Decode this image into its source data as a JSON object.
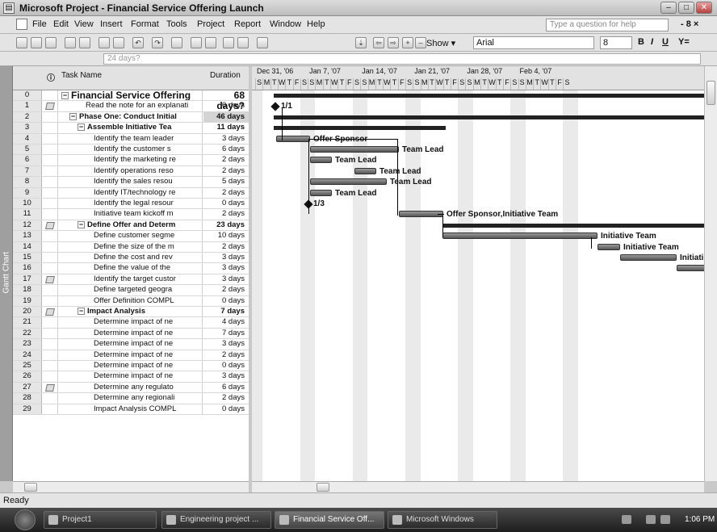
{
  "window": {
    "title": "Microsoft Project - Financial Service Offering Launch",
    "app_icon": "project-app-icon",
    "minimize_glyph": "–",
    "maximize_glyph": "□",
    "close_glyph": "✕"
  },
  "menu": {
    "items": [
      "File",
      "Edit",
      "View",
      "Insert",
      "Format",
      "Tools",
      "Project",
      "Report",
      "Window",
      "Help"
    ],
    "help_placeholder": "Type a question for help",
    "doc_controls": "- 8 ×"
  },
  "toolbar": {
    "icons": [
      "new-icon",
      "open-icon",
      "save-icon",
      "print-icon",
      "print-preview-icon",
      "cut-icon",
      "copy-icon",
      "undo-icon",
      "redo-icon",
      "hyperlink-icon",
      "link-tasks-icon",
      "unlink-tasks-icon",
      "split-icon",
      "task-info-icon",
      "group-icon",
      "scroll-to-task-icon",
      "indent-icon",
      "outdent-icon",
      "show-subtasks-icon",
      "hide-subtasks-icon"
    ],
    "show_label": "Show ▾",
    "font": "Arial",
    "font_size": "8",
    "bold": "B",
    "italic": "I",
    "underline": "U",
    "filter": "Y="
  },
  "entry": {
    "value": "24 days?"
  },
  "viewbar": {
    "label": "Gantt Chart"
  },
  "table": {
    "headers": {
      "id": "",
      "indicator": "ⓘ",
      "name": "Task Name",
      "duration": "Duration"
    },
    "rows": [
      {
        "id": "0",
        "name": "Financial Service Offering",
        "duration": "68 days?",
        "level": 0,
        "summary": true,
        "big": true,
        "note": false
      },
      {
        "id": "1",
        "name": "Read the note for an explanati",
        "duration": "0 days",
        "level": 3,
        "summary": false,
        "note": true
      },
      {
        "id": "2",
        "name": "Phase One: Conduct Initial",
        "duration": "46 days",
        "level": 1,
        "summary": true,
        "note": false,
        "hl": true
      },
      {
        "id": "3",
        "name": "Assemble Initiative Tea",
        "duration": "11 days",
        "level": 2,
        "summary": true,
        "note": false
      },
      {
        "id": "4",
        "name": "Identify the team leader",
        "duration": "3 days",
        "level": 4,
        "summary": false,
        "note": false
      },
      {
        "id": "5",
        "name": "Identify the customer s",
        "duration": "6 days",
        "level": 4,
        "summary": false,
        "note": false
      },
      {
        "id": "6",
        "name": "Identify the marketing re",
        "duration": "2 days",
        "level": 4,
        "summary": false,
        "note": false
      },
      {
        "id": "7",
        "name": "Identify operations reso",
        "duration": "2 days",
        "level": 4,
        "summary": false,
        "note": false
      },
      {
        "id": "8",
        "name": "Identify the sales resou",
        "duration": "5 days",
        "level": 4,
        "summary": false,
        "note": false
      },
      {
        "id": "9",
        "name": "Identify IT/technology re",
        "duration": "2 days",
        "level": 4,
        "summary": false,
        "note": false
      },
      {
        "id": "10",
        "name": "Identify the legal resour",
        "duration": "0 days",
        "level": 4,
        "summary": false,
        "note": false
      },
      {
        "id": "11",
        "name": "Initiative team kickoff m",
        "duration": "2 days",
        "level": 4,
        "summary": false,
        "note": false
      },
      {
        "id": "12",
        "name": "Define Offer and Determ",
        "duration": "23 days",
        "level": 2,
        "summary": true,
        "note": true
      },
      {
        "id": "13",
        "name": "Define customer segme",
        "duration": "10 days",
        "level": 4,
        "summary": false,
        "note": false
      },
      {
        "id": "14",
        "name": "Define the size of the m",
        "duration": "2 days",
        "level": 4,
        "summary": false,
        "note": false
      },
      {
        "id": "15",
        "name": "Define the cost and rev",
        "duration": "3 days",
        "level": 4,
        "summary": false,
        "note": false
      },
      {
        "id": "16",
        "name": "Define the value of the",
        "duration": "3 days",
        "level": 4,
        "summary": false,
        "note": false
      },
      {
        "id": "17",
        "name": "Identify the target custor",
        "duration": "3 days",
        "level": 4,
        "summary": false,
        "note": true
      },
      {
        "id": "18",
        "name": "Define targeted geogra",
        "duration": "2 days",
        "level": 4,
        "summary": false,
        "note": false
      },
      {
        "id": "19",
        "name": "Offer Definition COMPL",
        "duration": "0 days",
        "level": 4,
        "summary": false,
        "note": false
      },
      {
        "id": "20",
        "name": "Impact Analysis",
        "duration": "7 days",
        "level": 2,
        "summary": true,
        "note": true
      },
      {
        "id": "21",
        "name": "Determine impact of ne",
        "duration": "4 days",
        "level": 4,
        "summary": false,
        "note": false
      },
      {
        "id": "22",
        "name": "Determine impact of ne",
        "duration": "7 days",
        "level": 4,
        "summary": false,
        "note": false
      },
      {
        "id": "23",
        "name": "Determine impact of ne",
        "duration": "3 days",
        "level": 4,
        "summary": false,
        "note": false
      },
      {
        "id": "24",
        "name": "Determine impact of ne",
        "duration": "2 days",
        "level": 4,
        "summary": false,
        "note": false
      },
      {
        "id": "25",
        "name": "Determine impact of ne",
        "duration": "0 days",
        "level": 4,
        "summary": false,
        "note": false
      },
      {
        "id": "26",
        "name": "Determine impact of ne",
        "duration": "3 days",
        "level": 4,
        "summary": false,
        "note": false
      },
      {
        "id": "27",
        "name": "Determine any regulato",
        "duration": "6 days",
        "level": 4,
        "summary": false,
        "note": true
      },
      {
        "id": "28",
        "name": "Determine any regionali",
        "duration": "2 days",
        "level": 4,
        "summary": false,
        "note": false
      },
      {
        "id": "29",
        "name": "Impact Analysis COMPL",
        "duration": "0 days",
        "level": 4,
        "summary": false,
        "note": false
      }
    ]
  },
  "gantt": {
    "weeks": [
      "Dec 31, '06",
      "Jan 7, '07",
      "Jan 14, '07",
      "Jan 21, '07",
      "Jan 28, '07",
      "Feb 4, '07"
    ],
    "day_letters": [
      "S",
      "M",
      "T",
      "W",
      "T",
      "F",
      "S"
    ],
    "labels": {
      "r1": "1/1",
      "r4": "Offer Sponsor",
      "r5": "Team Lead",
      "r6": "Team Lead",
      "r7": "Team Lead",
      "r8": "Team Lead",
      "r9": "Team Lead",
      "r10": "1/3",
      "r11": "Offer Sponsor,Initiative Team",
      "r13": "Initiative Team",
      "r14": "Initiative Team",
      "r15": "Initiati"
    }
  },
  "status": {
    "text": "Ready"
  },
  "taskbar": {
    "buttons": [
      "Project1",
      "Engineering project ...",
      "Financial Service Off...",
      "Microsoft Windows"
    ],
    "clock": "1:06 PM"
  }
}
